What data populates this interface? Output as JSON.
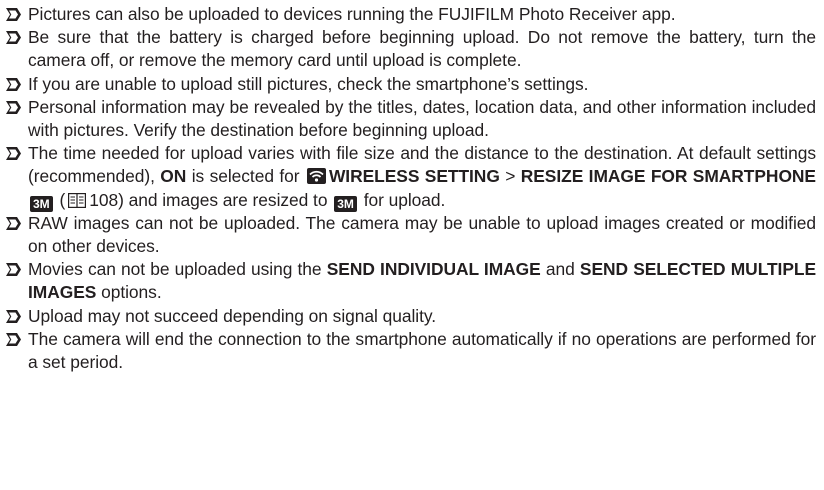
{
  "notes": [
    {
      "text": "Pictures can also be uploaded to devices running the FUJIFILM Photo Receiver app."
    },
    {
      "text": "Be sure that the battery is charged before beginning upload.  Do not remove the battery, turn the camera off, or remove the memory card until upload is complete."
    },
    {
      "text": "If you are unable to upload still pictures, check the smartphone’s settings."
    },
    {
      "text": "Personal information may be revealed by the titles, dates, location data, and other information included with pictures. Verify the destination before beginning upload."
    },
    {
      "part1": "The time needed for upload varies with file size and the distance to the destination. At default settings (recommended), ",
      "on": "ON",
      "part2": " is selected for ",
      "wireless_setting": "WIRELESS SETTING",
      "gt": " > ",
      "resize": "RESIZE IMAGE FOR SMARTPHONE",
      "size_badge": "3M",
      "paren_open": " (",
      "page_ref": "108",
      "part3": ") and images are resized to ",
      "size_badge2": "3M",
      "part4": " for upload."
    },
    {
      "text": "RAW images can not be uploaded.  The camera may be unable to upload images created or modified on other devices."
    },
    {
      "part1": "Movies can not be uploaded using the ",
      "send_individual": "SEND INDIVIDUAL IMAGE",
      "and": " and ",
      "send_multiple": "SEND SE­LECTED MULTIPLE IMAGES",
      "part2": " options."
    },
    {
      "text": "Upload may not succeed depending on signal quality."
    },
    {
      "text": "The camera will end the connection to the smartphone automatically if no opera­tions are performed for a set period."
    }
  ],
  "icons": {
    "bullet": "diamond-arrow-bullet-icon",
    "wireless": "wireless-setting-icon",
    "page_reference": "book-page-reference-icon"
  },
  "colors": {
    "text": "#231f20",
    "bullet": "#231f20"
  }
}
